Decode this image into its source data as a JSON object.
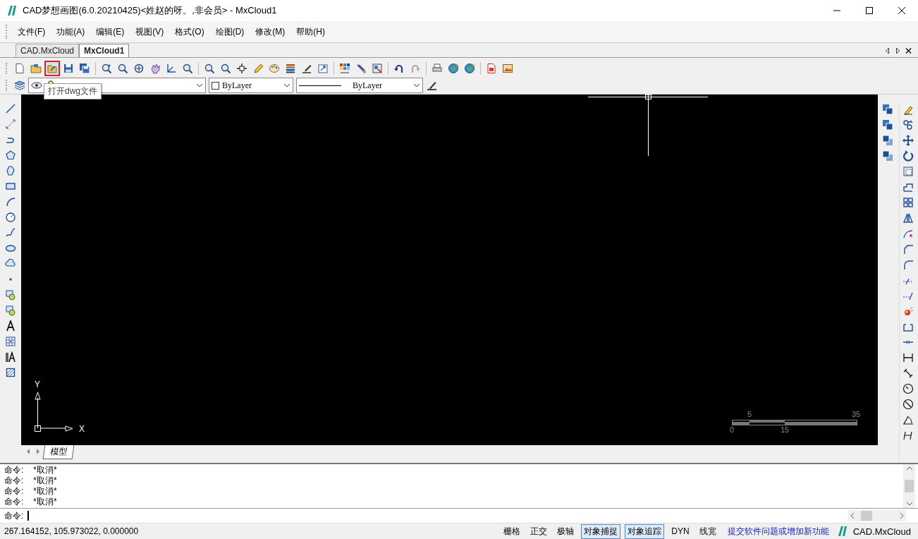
{
  "window": {
    "title": "CAD梦想画图(6.0.20210425)<姓赵的呀。,非会员> - MxCloud1"
  },
  "menu": [
    "文件(F)",
    "功能(A)",
    "编辑(E)",
    "视图(V)",
    "格式(O)",
    "绘图(D)",
    "修改(M)",
    "帮助(H)"
  ],
  "doc_tabs": [
    {
      "label": "CAD.MxCloud",
      "selected": false
    },
    {
      "label": "MxCloud1",
      "selected": true
    }
  ],
  "toolbar_buttons": [
    {
      "selected": false
    },
    {
      "selected": false
    },
    {
      "selected": true
    },
    {
      "selected": false
    },
    {
      "selected": false
    },
    {
      "selected": false
    },
    {
      "selected": false
    },
    {
      "selected": false
    },
    {
      "selected": false
    },
    {
      "selected": false
    },
    {
      "selected": false
    },
    {
      "selected": false
    },
    {
      "selected": false
    },
    {
      "selected": false
    },
    {
      "selected": false
    },
    {
      "selected": false
    },
    {
      "selected": false
    },
    {
      "selected": false
    },
    {
      "selected": false
    },
    {
      "selected": false
    },
    {
      "selected": false
    },
    {
      "selected": false
    },
    {
      "selected": false
    },
    {
      "selected": false
    },
    {
      "selected": false
    },
    {
      "selected": false
    },
    {
      "selected": false
    },
    {
      "selected": false
    },
    {
      "selected": false
    }
  ],
  "tooltip": {
    "text": "打开dwg文件"
  },
  "properties": {
    "pen_setting": "ByLayer",
    "linetype": "ByLayer"
  },
  "canvas": {
    "axis_labels": [
      "Y",
      "X"
    ],
    "scale_top_labels": [
      "5",
      "35"
    ],
    "scale_bottom_labels": [
      "0",
      "15"
    ]
  },
  "layout_tabs": [
    {
      "label": "模型",
      "selected": true
    }
  ],
  "command": {
    "history": [
      {
        "prompt": "命令:",
        "text": "*取消*"
      },
      {
        "prompt": "命令:",
        "text": "*取消*"
      },
      {
        "prompt": "命令:",
        "text": "*取消*"
      },
      {
        "prompt": "命令:",
        "text": "*取消*"
      }
    ],
    "prompt": "命令:"
  },
  "status": {
    "coordinates": "267.164152, 105.973022, 0.000000",
    "toggles": [
      {
        "label": "栅格",
        "on": false
      },
      {
        "label": "正交",
        "on": false
      },
      {
        "label": "极轴",
        "on": false
      },
      {
        "label": "对象捕捉",
        "on": true
      },
      {
        "label": "对象追踪",
        "on": true
      },
      {
        "label": "DYN",
        "on": false
      },
      {
        "label": "线宽",
        "on": false
      }
    ],
    "link": "提交软件问题或增加新功能",
    "brand": "CAD.MxCloud"
  }
}
